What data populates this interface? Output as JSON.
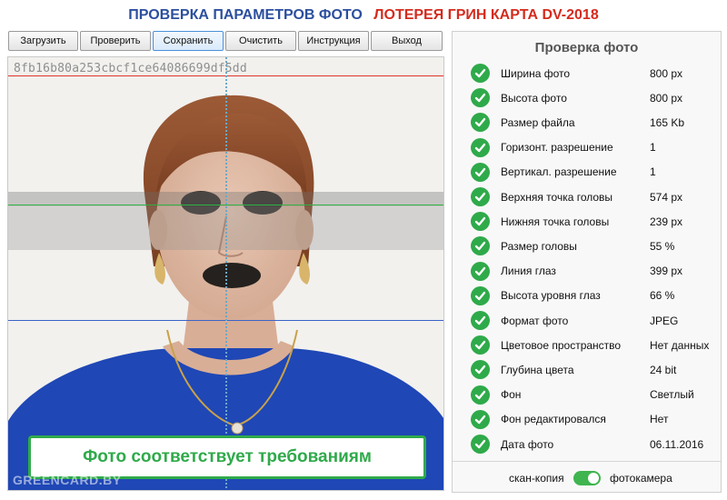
{
  "header": {
    "title_left": "ПРОВЕРКА ПАРАМЕТРОВ ФОТО",
    "title_right": "ЛОТЕРЕЯ ГРИН КАРТА DV-2018"
  },
  "toolbar": {
    "load": "Загрузить",
    "check": "Проверить",
    "save": "Сохранить",
    "clear": "Очистить",
    "instructions": "Инструкция",
    "exit": "Выход"
  },
  "photo": {
    "hash": "8fb16b80a253cbcf1ce64086699df5dd",
    "status": "Фото соответствует требованиям",
    "watermark": "GREENCARD.BY"
  },
  "panel": {
    "title": "Проверка фото",
    "checks": [
      {
        "label": "Ширина фото",
        "value": "800 px"
      },
      {
        "label": "Высота фото",
        "value": "800 px"
      },
      {
        "label": "Размер файла",
        "value": "165 Kb"
      },
      {
        "label": "Горизонт. разрешение",
        "value": "1"
      },
      {
        "label": "Вертикал. разрешение",
        "value": "1"
      },
      {
        "label": "Верхняя точка головы",
        "value": "574 px"
      },
      {
        "label": "Нижняя точка головы",
        "value": "239 px"
      },
      {
        "label": "Размер головы",
        "value": "55 %"
      },
      {
        "label": "Линия глаз",
        "value": "399 px"
      },
      {
        "label": "Высота уровня глаз",
        "value": "66 %"
      },
      {
        "label": "Формат фото",
        "value": "JPEG"
      },
      {
        "label": "Цветовое пространство",
        "value": "Нет данных"
      },
      {
        "label": "Глубина цвета",
        "value": "24 bit"
      },
      {
        "label": "Фон",
        "value": "Светлый"
      },
      {
        "label": "Фон редактировался",
        "value": "Нет"
      },
      {
        "label": "Дата фото",
        "value": "06.11.2016"
      }
    ],
    "toggle": {
      "left_label": "скан-копия",
      "right_label": "фотокамера",
      "on": true
    }
  },
  "colors": {
    "accent_green": "#2faa4a",
    "title_blue": "#2b4f9e",
    "title_red": "#d42b1e"
  }
}
